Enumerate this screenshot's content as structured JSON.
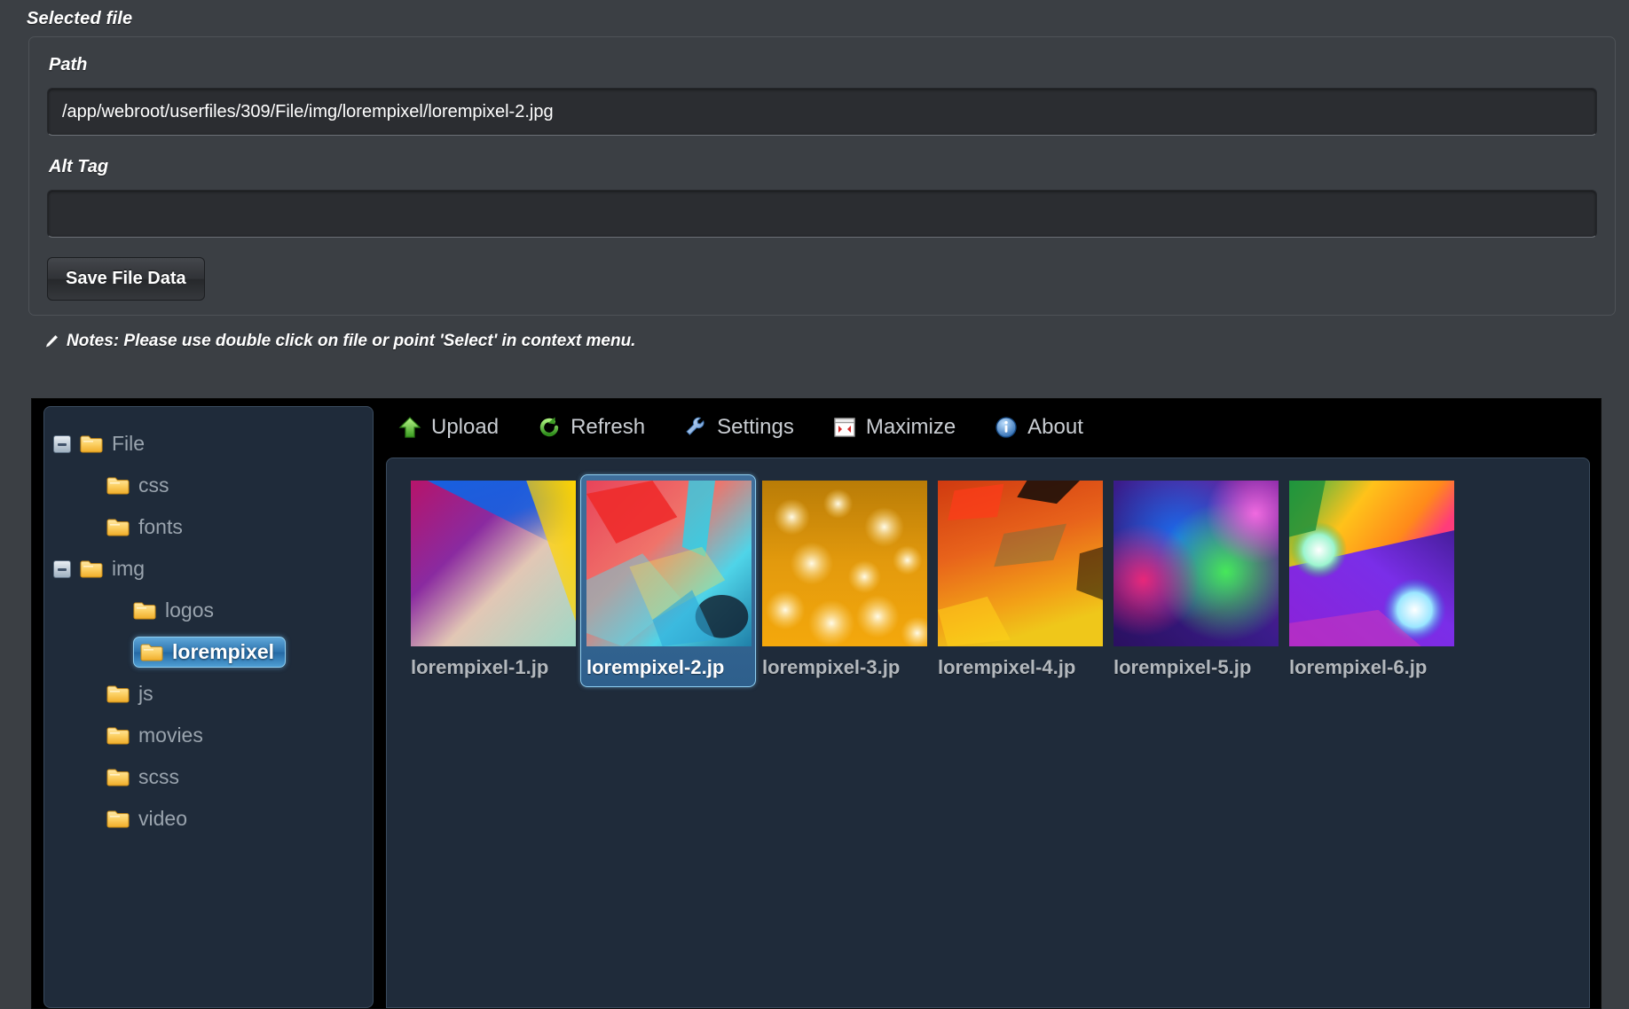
{
  "selected_file": {
    "legend": "Selected file",
    "path_label": "Path",
    "path_value": "/app/webroot/userfiles/309/File/img/lorempixel/lorempixel-2.jpg",
    "alt_label": "Alt Tag",
    "alt_value": "",
    "alt_placeholder": "",
    "save_button": "Save File Data"
  },
  "notes": {
    "icon": "pencil-icon",
    "text": "Notes: Please use double click on file or point 'Select' in context menu."
  },
  "toolbar": {
    "items": [
      {
        "label": "Upload",
        "icon": "upload-arrow-icon"
      },
      {
        "label": "Refresh",
        "icon": "refresh-icon"
      },
      {
        "label": "Settings",
        "icon": "wrench-icon"
      },
      {
        "label": "Maximize",
        "icon": "maximize-icon"
      },
      {
        "label": "About",
        "icon": "info-icon"
      }
    ]
  },
  "tree": {
    "items": [
      {
        "label": "File",
        "depth": 0,
        "toggle": "minus",
        "selected": false
      },
      {
        "label": "css",
        "depth": 1,
        "toggle": "none",
        "selected": false
      },
      {
        "label": "fonts",
        "depth": 1,
        "toggle": "none",
        "selected": false
      },
      {
        "label": "img",
        "depth": 0,
        "toggle": "minus",
        "selected": false
      },
      {
        "label": "logos",
        "depth": 2,
        "toggle": "none",
        "selected": false
      },
      {
        "label": "lorempixel",
        "depth": 2,
        "toggle": "none",
        "selected": true
      },
      {
        "label": "js",
        "depth": 1,
        "toggle": "none",
        "selected": false
      },
      {
        "label": "movies",
        "depth": 1,
        "toggle": "none",
        "selected": false
      },
      {
        "label": "scss",
        "depth": 1,
        "toggle": "none",
        "selected": false
      },
      {
        "label": "video",
        "depth": 1,
        "toggle": "none",
        "selected": false
      }
    ]
  },
  "files": {
    "items": [
      {
        "name": "lorempixel-1.jp",
        "selected": false,
        "thumb": "t1"
      },
      {
        "name": "lorempixel-2.jp",
        "selected": true,
        "thumb": "t2"
      },
      {
        "name": "lorempixel-3.jp",
        "selected": false,
        "thumb": "t3"
      },
      {
        "name": "lorempixel-4.jp",
        "selected": false,
        "thumb": "t4"
      },
      {
        "name": "lorempixel-5.jp",
        "selected": false,
        "thumb": "t5"
      },
      {
        "name": "lorempixel-6.jp",
        "selected": false,
        "thumb": "t6"
      }
    ]
  },
  "colors": {
    "page_bg": "#3b3f44",
    "panel_bg": "#1f2b3a",
    "toolbar_bg": "#000000",
    "accent_selection": "#2f76b0",
    "selection_border": "#8fcdef",
    "input_bg": "#2b2d31",
    "text_muted": "#9aa4ae"
  }
}
